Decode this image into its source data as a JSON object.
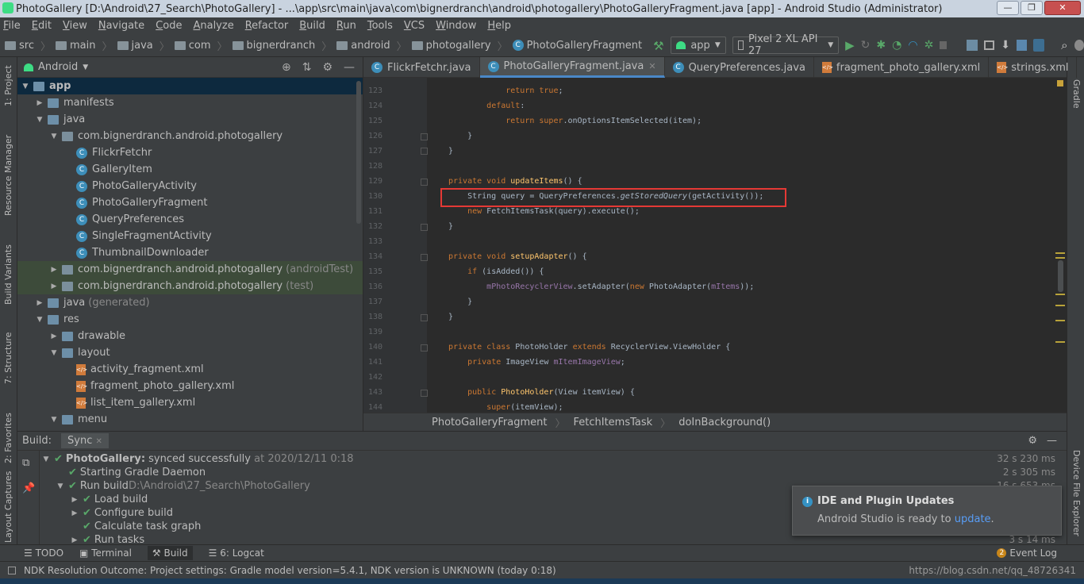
{
  "window": {
    "title": "PhotoGallery [D:\\Android\\27_Search\\PhotoGallery] - ...\\app\\src\\main\\java\\com\\bignerdranch\\android\\photogallery\\PhotoGalleryFragment.java [app] - Android Studio (Administrator)"
  },
  "menu": [
    "File",
    "Edit",
    "View",
    "Navigate",
    "Code",
    "Analyze",
    "Refactor",
    "Build",
    "Run",
    "Tools",
    "VCS",
    "Window",
    "Help"
  ],
  "nav": {
    "crumbs": [
      "src",
      "main",
      "java",
      "com",
      "bignerdranch",
      "android",
      "photogallery",
      "PhotoGalleryFragment"
    ],
    "run_config": "app",
    "device": "Pixel 2 XL API 27"
  },
  "left_strip": [
    "1: Project",
    "Resource Manager",
    "Build Variants",
    "7: Structure",
    "2: Favorites",
    "Layout Captures"
  ],
  "right_strip": [
    "Gradle",
    "Device File Explorer"
  ],
  "project": {
    "view": "Android",
    "tree": [
      {
        "label": "app",
        "indent": 0,
        "arrow": "▼",
        "icon": "folder",
        "bold": true,
        "sel": true
      },
      {
        "label": "manifests",
        "indent": 1,
        "arrow": "▶",
        "icon": "folder"
      },
      {
        "label": "java",
        "indent": 1,
        "arrow": "▼",
        "icon": "folder"
      },
      {
        "label": "com.bignerdranch.android.photogallery",
        "indent": 2,
        "arrow": "▼",
        "icon": "pkg"
      },
      {
        "label": "FlickrFetchr",
        "indent": 3,
        "arrow": "",
        "icon": "class"
      },
      {
        "label": "GalleryItem",
        "indent": 3,
        "arrow": "",
        "icon": "class"
      },
      {
        "label": "PhotoGalleryActivity",
        "indent": 3,
        "arrow": "",
        "icon": "class"
      },
      {
        "label": "PhotoGalleryFragment",
        "indent": 3,
        "arrow": "",
        "icon": "class"
      },
      {
        "label": "QueryPreferences",
        "indent": 3,
        "arrow": "",
        "icon": "class"
      },
      {
        "label": "SingleFragmentActivity",
        "indent": 3,
        "arrow": "",
        "icon": "class"
      },
      {
        "label": "ThumbnailDownloader",
        "indent": 3,
        "arrow": "",
        "icon": "class"
      },
      {
        "label": "com.bignerdranch.android.photogallery",
        "suffix": "(androidTest)",
        "indent": 2,
        "arrow": "▶",
        "icon": "pkg",
        "hl": true
      },
      {
        "label": "com.bignerdranch.android.photogallery",
        "suffix": "(test)",
        "indent": 2,
        "arrow": "▶",
        "icon": "pkg",
        "hl": true
      },
      {
        "label": "java",
        "suffix": "(generated)",
        "indent": 1,
        "arrow": "▶",
        "icon": "folder"
      },
      {
        "label": "res",
        "indent": 1,
        "arrow": "▼",
        "icon": "folder"
      },
      {
        "label": "drawable",
        "indent": 2,
        "arrow": "▶",
        "icon": "folder"
      },
      {
        "label": "layout",
        "indent": 2,
        "arrow": "▼",
        "icon": "folder"
      },
      {
        "label": "activity_fragment.xml",
        "indent": 3,
        "arrow": "",
        "icon": "xml"
      },
      {
        "label": "fragment_photo_gallery.xml",
        "indent": 3,
        "arrow": "",
        "icon": "xml"
      },
      {
        "label": "list_item_gallery.xml",
        "indent": 3,
        "arrow": "",
        "icon": "xml"
      },
      {
        "label": "menu",
        "indent": 2,
        "arrow": "▼",
        "icon": "folder"
      }
    ]
  },
  "tabs": [
    {
      "label": "FlickrFetchr.java",
      "icon": "C",
      "active": false
    },
    {
      "label": "PhotoGalleryFragment.java",
      "icon": "C",
      "active": true
    },
    {
      "label": "QueryPreferences.java",
      "icon": "C",
      "active": false
    },
    {
      "label": "fragment_photo_gallery.xml",
      "icon": "xml",
      "active": false
    },
    {
      "label": "strings.xml",
      "icon": "xml",
      "active": false
    }
  ],
  "editor": {
    "lines": [
      {
        "n": "123",
        "html": "            <span class=\"kw\">return true</span>;"
      },
      {
        "n": "124",
        "html": "        <span class=\"kw\">default</span>:"
      },
      {
        "n": "125",
        "html": "            <span class=\"kw\">return super</span>.onOptionsItemSelected(item);"
      },
      {
        "n": "126",
        "html": "    }"
      },
      {
        "n": "127",
        "html": "}"
      },
      {
        "n": "128",
        "html": ""
      },
      {
        "n": "129",
        "html": "<span class=\"kw\">private void</span> <span class=\"fn\">updateItems</span>() {"
      },
      {
        "n": "130",
        "html": "    String query = QueryPreferences.<span class=\"ital\">getStoredQuery</span>(getActivity());"
      },
      {
        "n": "131",
        "html": "    <span class=\"kw\">new</span> FetchItemsTask(query).execute();"
      },
      {
        "n": "132",
        "html": "}"
      },
      {
        "n": "133",
        "html": ""
      },
      {
        "n": "134",
        "html": "<span class=\"kw\">private void</span> <span class=\"fn\">setupAdapter</span>() {"
      },
      {
        "n": "135",
        "html": "    <span class=\"kw\">if</span> (isAdded()) {"
      },
      {
        "n": "136",
        "html": "        <span class=\"fld\">mPhotoRecyclerView</span>.setAdapter(<span class=\"kw\">new</span> PhotoAdapter(<span class=\"fld\">mItems</span>));"
      },
      {
        "n": "137",
        "html": "    }"
      },
      {
        "n": "138",
        "html": "}"
      },
      {
        "n": "139",
        "html": ""
      },
      {
        "n": "140",
        "html": "<span class=\"kw\">private class</span> PhotoHolder <span class=\"kw\">extends</span> RecyclerView.ViewHolder {"
      },
      {
        "n": "141",
        "html": "    <span class=\"kw\">private</span> ImageView <span class=\"fld\">mItemImageView</span>;"
      },
      {
        "n": "142",
        "html": ""
      },
      {
        "n": "143",
        "html": "    <span class=\"kw\">public</span> <span class=\"fn\">PhotoHolder</span>(View itemView) {"
      },
      {
        "n": "144",
        "html": "        <span class=\"kw\">super</span>(itemView);"
      }
    ]
  },
  "editor_breadcrumbs": [
    "PhotoGalleryFragment",
    "FetchItemsTask",
    "doInBackground()"
  ],
  "build": {
    "label": "Build:",
    "tab": "Sync",
    "rows": [
      {
        "text": "PhotoGallery:",
        "rest": " synced successfully ",
        "dim": "at 2020/12/11 0:18",
        "time": "32 s 230 ms",
        "level": 0,
        "arrow": "▼"
      },
      {
        "text": "Starting Gradle Daemon",
        "time": "2 s 305 ms",
        "level": 1,
        "arrow": ""
      },
      {
        "text": "Run build ",
        "dim": "D:\\Android\\27_Search\\PhotoGallery",
        "time": "16 s 653 ms",
        "level": 1,
        "arrow": "▼"
      },
      {
        "text": "Load build",
        "time": "",
        "level": 2,
        "arrow": "▶"
      },
      {
        "text": "Configure build",
        "time": "",
        "level": 2,
        "arrow": "▶"
      },
      {
        "text": "Calculate task graph",
        "time": "",
        "level": 2,
        "arrow": ""
      },
      {
        "text": "Run tasks",
        "time": "3 s 14 ms",
        "level": 2,
        "arrow": "▶"
      }
    ]
  },
  "notification": {
    "title": "IDE and Plugin Updates",
    "body": "Android Studio is ready to ",
    "link": "update",
    "end": "."
  },
  "bottom_tabs": [
    "TODO",
    "Terminal",
    "Build",
    "6: Logcat"
  ],
  "event_log": {
    "count": "2",
    "label": "Event Log"
  },
  "status": {
    "message": "NDK Resolution Outcome: Project settings: Gradle model version=5.4.1, NDK version is UNKNOWN (today 0:18)",
    "watermark": "https://blog.csdn.net/qq_48726341"
  }
}
